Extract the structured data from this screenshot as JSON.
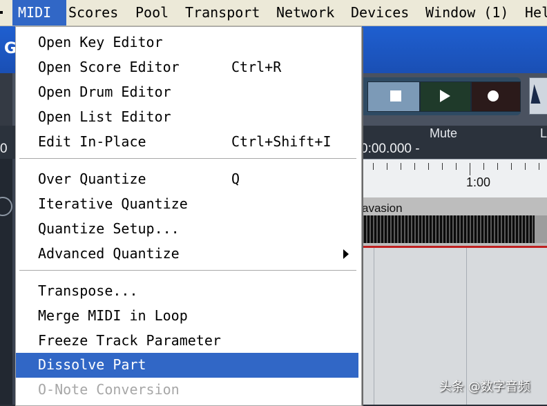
{
  "menubar": {
    "items": [
      "MIDI",
      "Scores",
      "Pool",
      "Transport",
      "Network",
      "Devices",
      "Window (1)",
      "Help"
    ],
    "active": "MIDI"
  },
  "background": {
    "transport": {
      "mute_label": "Mute",
      "l_label": "L",
      "time_readout": "0:00.000 -",
      "left_time": "0"
    },
    "ruler_label": "1:00",
    "track_name": "avasion"
  },
  "menu": {
    "group1": [
      {
        "label": "Open Key Editor",
        "shortcut": ""
      },
      {
        "label": "Open Score Editor",
        "shortcut": "Ctrl+R"
      },
      {
        "label": "Open Drum Editor",
        "shortcut": ""
      },
      {
        "label": "Open List Editor",
        "shortcut": ""
      },
      {
        "label": "Edit In-Place",
        "shortcut": "Ctrl+Shift+I"
      }
    ],
    "group2": [
      {
        "label": "Over Quantize",
        "shortcut": "Q"
      },
      {
        "label": "Iterative Quantize",
        "shortcut": ""
      },
      {
        "label": "Quantize Setup...",
        "shortcut": ""
      },
      {
        "label": "Advanced Quantize",
        "shortcut": ""
      }
    ],
    "group3": [
      {
        "label": "Transpose...",
        "shortcut": ""
      },
      {
        "label": "Merge MIDI in Loop",
        "shortcut": ""
      },
      {
        "label": "Freeze Track Parameter",
        "shortcut": ""
      },
      {
        "label": "Dissolve Part",
        "shortcut": ""
      },
      {
        "label": "O-Note Conversion",
        "shortcut": ""
      }
    ],
    "highlighted": "Dissolve Part",
    "disabled": [
      "O-Note Conversion"
    ]
  },
  "watermark": "头条 @数字音频"
}
